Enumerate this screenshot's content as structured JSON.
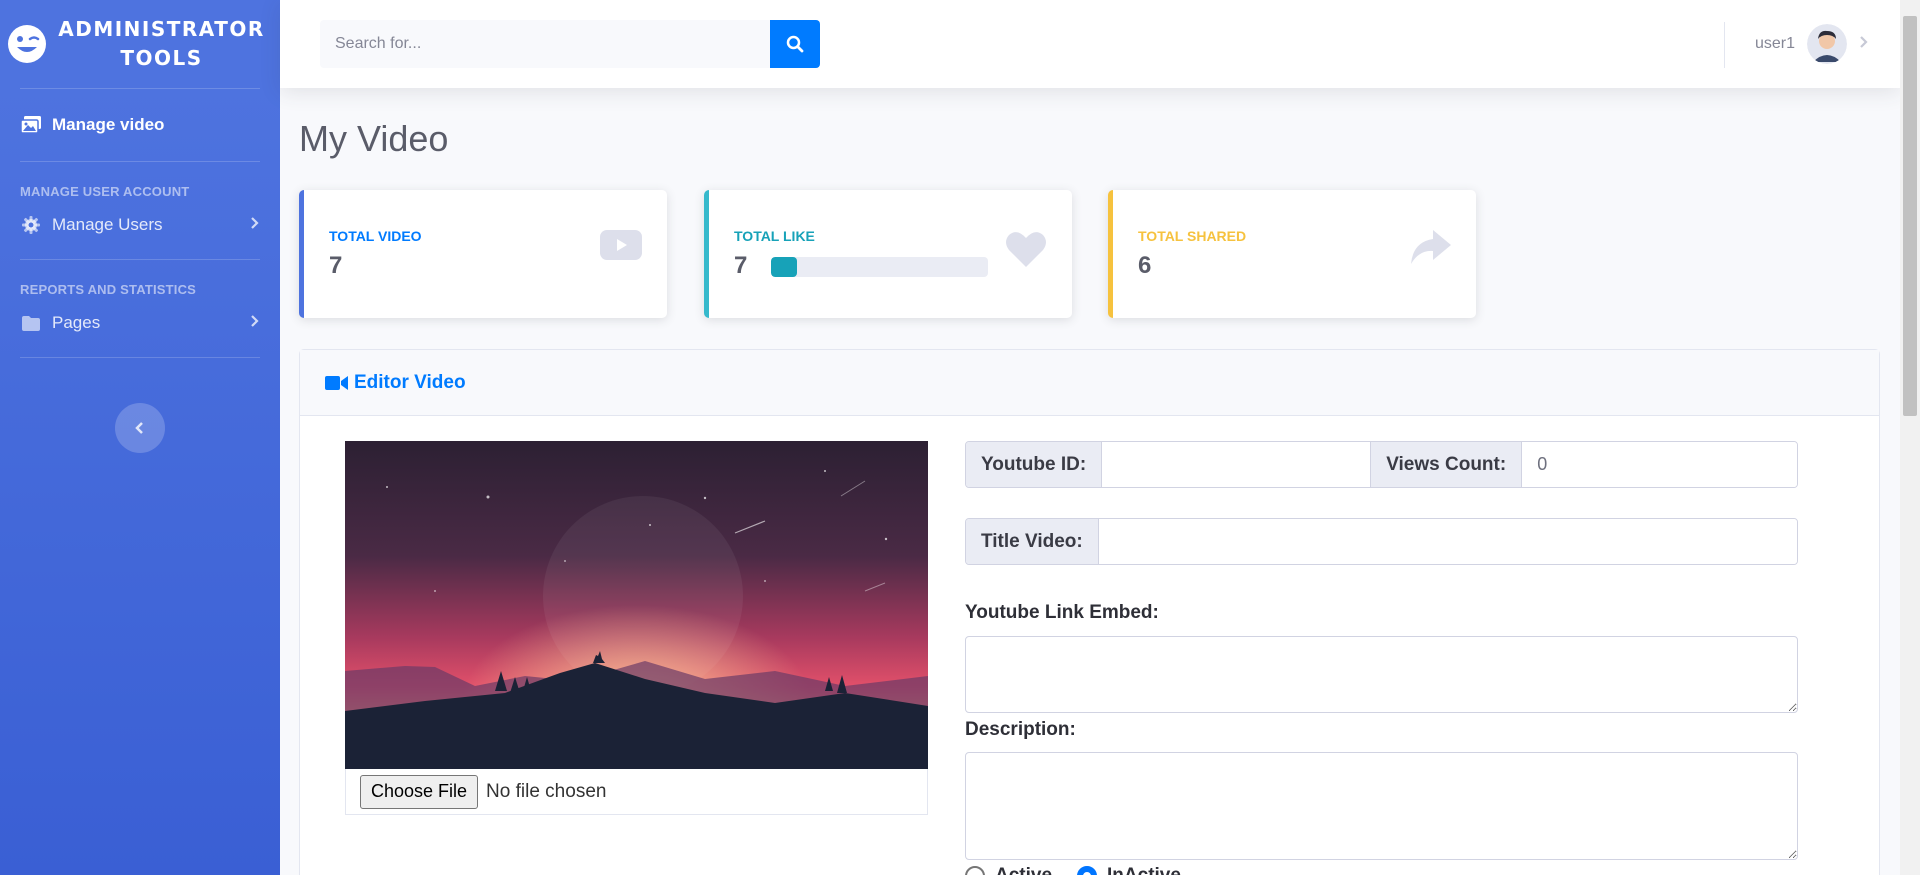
{
  "sidebar": {
    "brand_line1": "ADMINISTRATOR",
    "brand_line2": "TOOLS",
    "brand_icon": "wink-smiley-icon",
    "active_item": "Manage video",
    "heading_user": "MANAGE USER ACCOUNT",
    "item_users": "Manage Users",
    "heading_reports": "REPORTS AND STATISTICS",
    "item_pages": "Pages"
  },
  "topbar": {
    "search_placeholder": "Search for...",
    "user_name": "user1"
  },
  "main": {
    "title": "My Video",
    "cards": [
      {
        "label": "TOTAL VIDEO",
        "value": "7",
        "color": "#4e73df",
        "icon": "youtube-play-icon"
      },
      {
        "label": "TOTAL LIKE",
        "value": "7",
        "color": "#36b9cc",
        "icon": "heart-icon",
        "progress_percent": 12
      },
      {
        "label": "TOTAL SHARED",
        "value": "6",
        "color": "#f6c23e",
        "icon": "share-icon"
      }
    ],
    "editor": {
      "title": "Editor Video",
      "file_button": "Choose File",
      "file_status": "No file chosen",
      "youtube_id_label": "Youtube ID:",
      "youtube_id_value": "",
      "views_label": "Views Count:",
      "views_value": "0",
      "title_label": "Title Video:",
      "title_value": "",
      "embed_label": "Youtube Link Embed:",
      "description_label": "Description:",
      "radio_active": "Active",
      "radio_inactive": "InActive"
    }
  },
  "colors": {
    "sidebar": "#4e73df",
    "accent": "#007bff",
    "info": "#36b9cc",
    "warning": "#f6c23e"
  }
}
